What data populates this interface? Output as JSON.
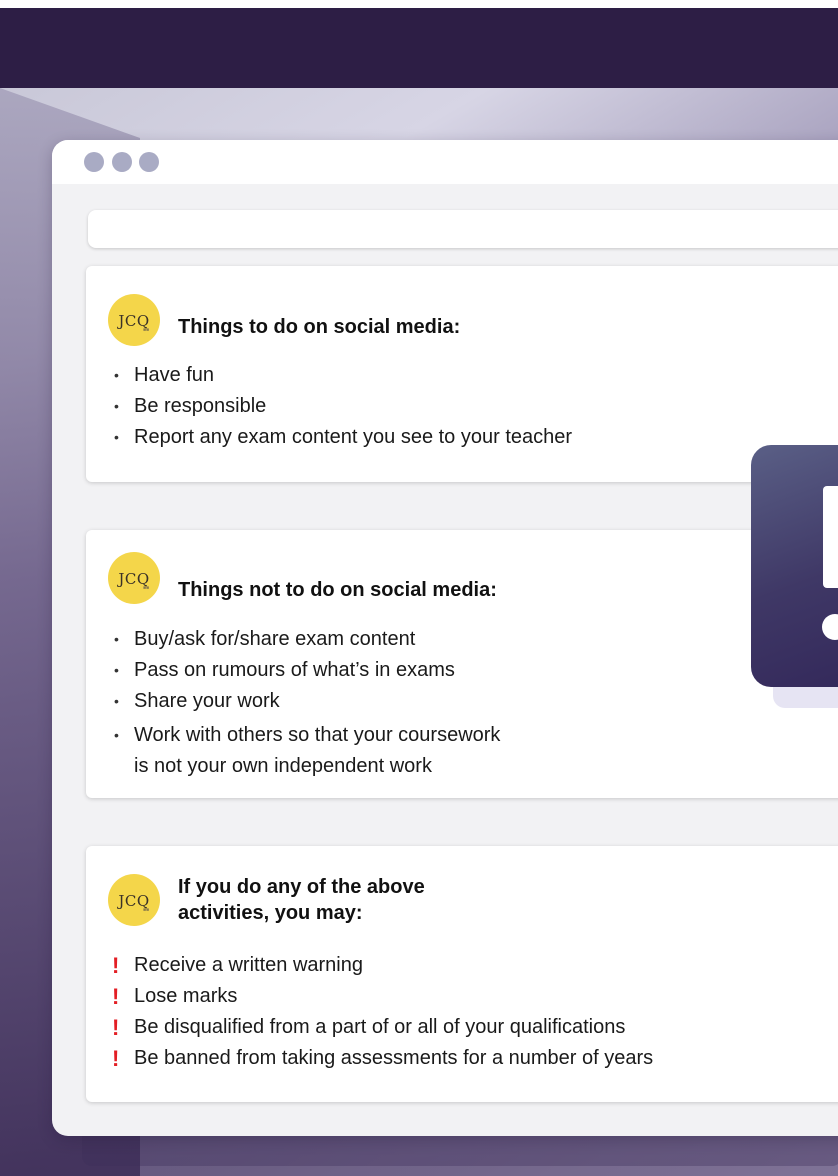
{
  "badge": {
    "label": "JCQ"
  },
  "cards": [
    {
      "title": "Things to do on social media:",
      "items": [
        "Have fun",
        "Be responsible",
        "Report any exam content you see to your teacher"
      ]
    },
    {
      "title": "Things not to do on social media:",
      "items": [
        "Buy/ask for/share exam content",
        "Pass on rumours of what’s in exams",
        "Share your work",
        "Work with others so that your coursework",
        "is not your own independent work"
      ]
    },
    {
      "title_line1": "If you do any of the above",
      "title_line2": "activities, you may:",
      "items": [
        "Receive a written warning",
        "Lose marks",
        "Be disqualified from a part of or all of your qualifications",
        "Be banned from taking assessments for a number of years"
      ]
    }
  ],
  "symbols": {
    "bullet": "•",
    "warn": "!"
  },
  "colors": {
    "header": "#2d1e45",
    "badge": "#f4d64a",
    "warn": "#e31e24",
    "alert_panel": "#3f3866"
  },
  "icons": [
    "jcq-logo",
    "alert-exclamation-icon",
    "window-control-dots"
  ]
}
